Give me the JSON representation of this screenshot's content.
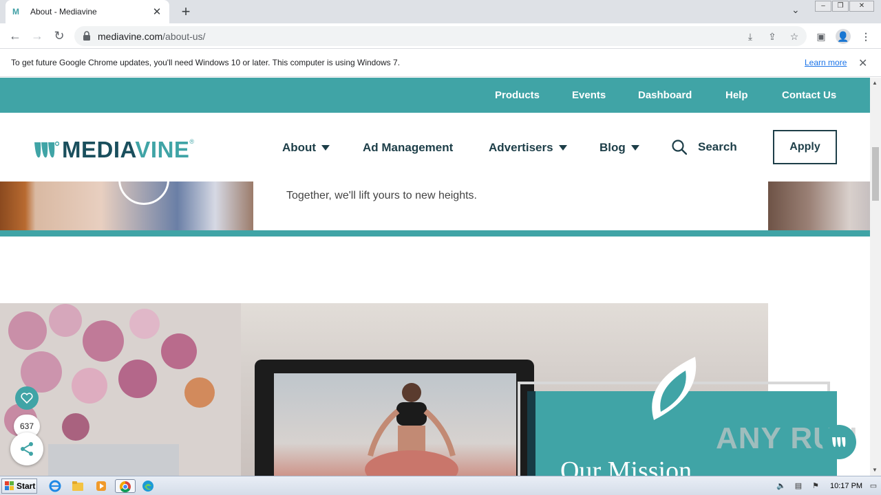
{
  "browser": {
    "tab_title": "About - Mediavine",
    "tab_favicon": "M",
    "url_host": "mediavine.com",
    "url_path": "/about-us/",
    "infobar_text": "To get future Google Chrome updates, you'll need Windows 10 or later. This computer is using Windows 7.",
    "infobar_link": "Learn more"
  },
  "site": {
    "utility_nav": [
      "Products",
      "Events",
      "Dashboard",
      "Help",
      "Contact Us"
    ],
    "logo_text_a": "MEDIA",
    "logo_text_b": "VINE",
    "logo_reg": "®",
    "main_nav": {
      "about": "About",
      "ad_management": "Ad Management",
      "advertisers": "Advertisers",
      "blog": "Blog",
      "search": "Search",
      "apply": "Apply"
    },
    "hero_text": "Together, we'll lift yours to new heights.",
    "mission_title": "Our Mission",
    "share_count": "637",
    "brand_teal": "#40a4a6",
    "brand_navy": "#1d3e48"
  },
  "overlay": {
    "watermark": "ANY RUN"
  },
  "taskbar": {
    "start_label": "Start",
    "clock": "10:17 PM"
  }
}
